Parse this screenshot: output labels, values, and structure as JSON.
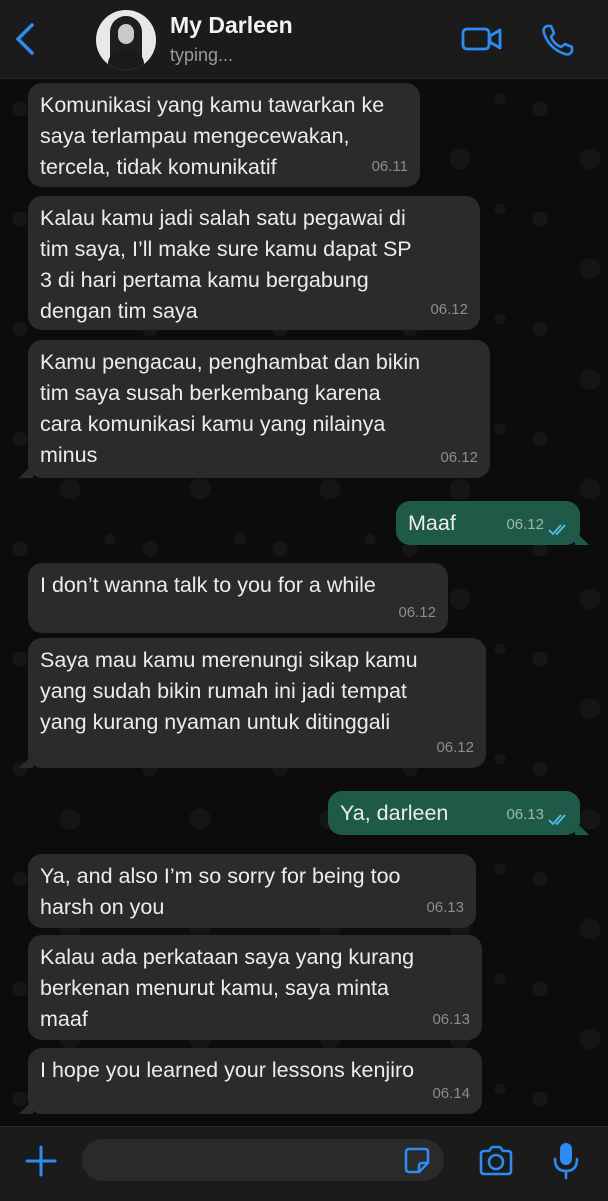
{
  "header": {
    "contact_name": "My Darleen",
    "status": "typing...",
    "icons": {
      "back": "chevron-left-icon",
      "video": "video-camera-icon",
      "call": "phone-icon"
    },
    "accent_color": "#2c8cf0"
  },
  "messages": [
    {
      "direction": "in",
      "text": "Komunikasi yang kamu tawarkan ke\nsaya terlampau mengecewakan,\ntercela, tidak komunikatif",
      "time": "06.11"
    },
    {
      "direction": "in",
      "text": "Kalau kamu jadi salah satu pegawai di\ntim saya, I’ll make sure kamu dapat SP\n3 di hari pertama kamu bergabung\ndengan tim saya",
      "time": "06.12"
    },
    {
      "direction": "in",
      "text": "Kamu pengacau, penghambat dan bikin\ntim saya susah berkembang karena\ncara komunikasi kamu yang nilainya\nminus",
      "time": "06.12"
    },
    {
      "direction": "out",
      "text": "Maaf",
      "time": "06.12",
      "status": "read"
    },
    {
      "direction": "in",
      "text": "I don’t wanna talk to you for a while",
      "time": "06.12"
    },
    {
      "direction": "in",
      "text": "Saya mau kamu merenungi sikap kamu\nyang sudah bikin rumah ini jadi tempat\nyang kurang nyaman untuk ditinggali",
      "time": "06.12"
    },
    {
      "direction": "out",
      "text": "Ya, darleen",
      "time": "06.13",
      "status": "read"
    },
    {
      "direction": "in",
      "text": "Ya, and also I’m so sorry for being too\nharsh on you",
      "time": "06.13"
    },
    {
      "direction": "in",
      "text": "Kalau ada perkataan saya yang kurang\nberkenan menurut kamu, saya minta\nmaaf",
      "time": "06.13"
    },
    {
      "direction": "in",
      "text": "I hope you learned your lessons kenjiro",
      "time": "06.14"
    }
  ],
  "composer": {
    "message_value": "",
    "icons": {
      "attach": "plus-icon",
      "sticker": "sticker-icon",
      "camera": "camera-icon",
      "mic": "microphone-icon"
    }
  },
  "colors": {
    "incoming_bubble": "#2b2b2d",
    "outgoing_bubble": "#1f5a48",
    "read_ticks": "#53bdeb"
  }
}
